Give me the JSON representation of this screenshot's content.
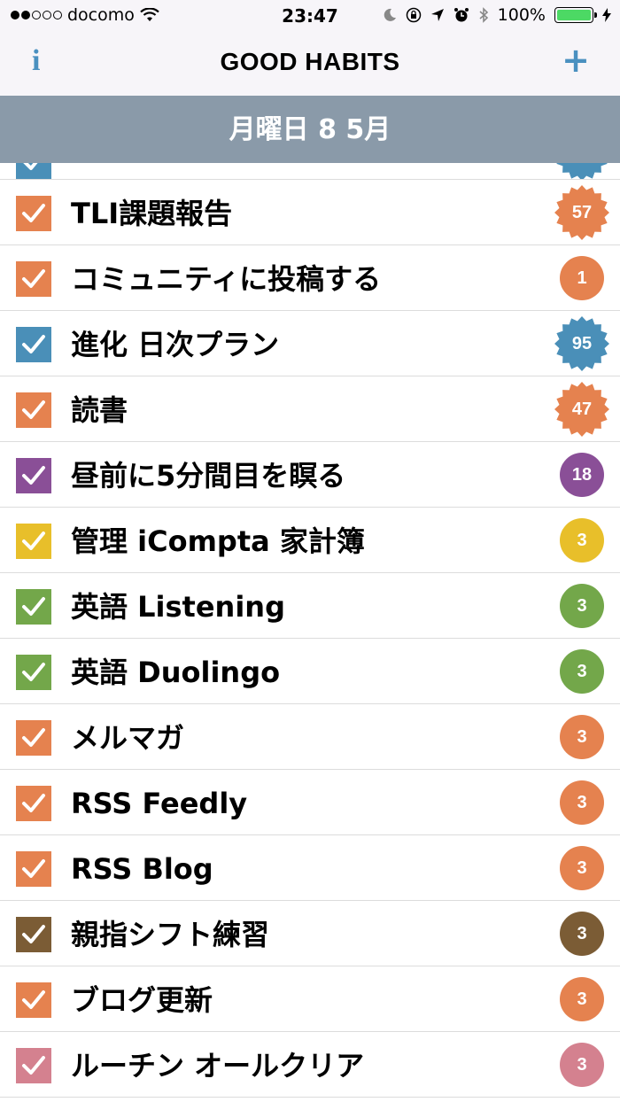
{
  "status": {
    "carrier": "docomo",
    "time": "23:47",
    "battery": "100%"
  },
  "nav": {
    "title": "GOOD HABITS",
    "info_icon": "i",
    "add_icon": "+"
  },
  "date_header": "月曜日 8 5月",
  "colors": {
    "orange": "#e5824f",
    "blue": "#4a8fb8",
    "purple": "#8a4f97",
    "yellow": "#e8bf2a",
    "green": "#73a74a",
    "brown": "#7b5c35",
    "pink": "#d4818f"
  },
  "habits": [
    {
      "label": "",
      "color": "blue",
      "count": "",
      "shape": "star",
      "partial": true
    },
    {
      "label": "TLI課題報告",
      "color": "orange",
      "count": "57",
      "shape": "star"
    },
    {
      "label": "コミュニティに投稿する",
      "color": "orange",
      "count": "1",
      "shape": "circle"
    },
    {
      "label": "進化 日次プラン",
      "color": "blue",
      "count": "95",
      "shape": "star"
    },
    {
      "label": "読書",
      "color": "orange",
      "count": "47",
      "shape": "star"
    },
    {
      "label": "昼前に5分間目を瞑る",
      "color": "purple",
      "count": "18",
      "shape": "circle"
    },
    {
      "label": "管理 iCompta 家計簿",
      "color": "yellow",
      "count": "3",
      "shape": "circle"
    },
    {
      "label": "英語 Listening",
      "color": "green",
      "count": "3",
      "shape": "circle"
    },
    {
      "label": "英語 Duolingo",
      "color": "green",
      "count": "3",
      "shape": "circle"
    },
    {
      "label": "メルマガ",
      "color": "orange",
      "count": "3",
      "shape": "circle"
    },
    {
      "label": "RSS Feedly",
      "color": "orange",
      "count": "3",
      "shape": "circle"
    },
    {
      "label": "RSS Blog",
      "color": "orange",
      "count": "3",
      "shape": "circle"
    },
    {
      "label": "親指シフト練習",
      "color": "brown",
      "count": "3",
      "shape": "circle"
    },
    {
      "label": "ブログ更新",
      "color": "orange",
      "count": "3",
      "shape": "circle"
    },
    {
      "label": "ルーチン オールクリア",
      "color": "pink",
      "count": "3",
      "shape": "circle"
    }
  ]
}
